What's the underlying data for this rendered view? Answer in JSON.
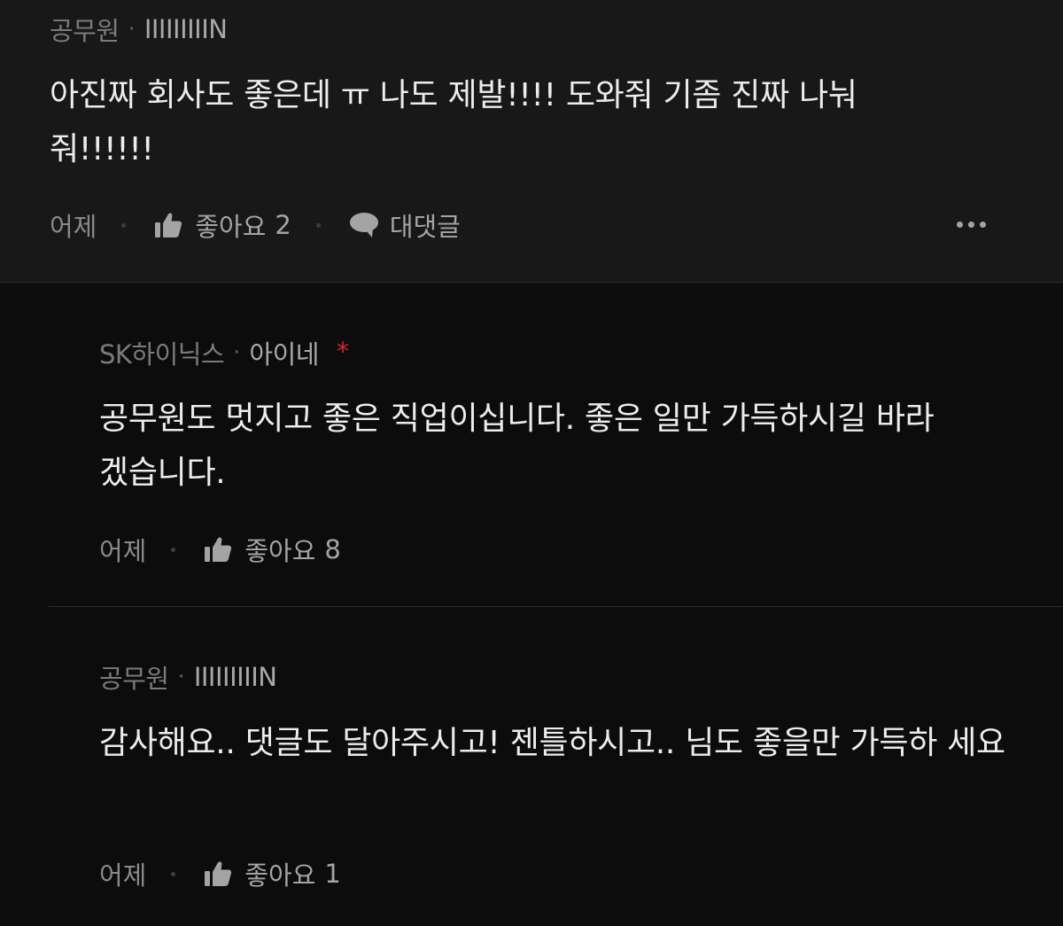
{
  "comments": [
    {
      "author": "공무원",
      "nickname": "IIIIIIIIIN",
      "body": "아진짜 회사도 좋은데 ㅠ 나도 제발!!!! 도와줘 기좀 진짜 나눠 줘!!!!!!",
      "time": "어제",
      "like_label": "좋아요",
      "like_count": "2",
      "reply_label": "대댓글"
    },
    {
      "author": "SK하이닉스",
      "nickname": "아이네",
      "badge": "*",
      "body": "공무원도 멋지고 좋은 직업이십니다. 좋은 일만 가득하시길 바라 겠습니다.",
      "time": "어제",
      "like_label": "좋아요",
      "like_count": "8"
    },
    {
      "author": "공무원",
      "nickname": "IIIIIIIIIN",
      "body": "감사해요.. 댓글도 달아주시고! 젠틀하시고.. 님도 좋을만 가득하 세요",
      "time": "어제",
      "like_label": "좋아요",
      "like_count": "1"
    }
  ],
  "meta_separator": "·",
  "colors": {
    "top_bg": "#181818",
    "page_bg": "#0c0c0d",
    "body_text": "#ececef",
    "meta_text": "#7b7b7e",
    "badge": "#d7282a"
  },
  "icons": {
    "like": "thumbs-up-icon",
    "reply": "speech-bubble-icon",
    "more": "more-dots-icon"
  }
}
